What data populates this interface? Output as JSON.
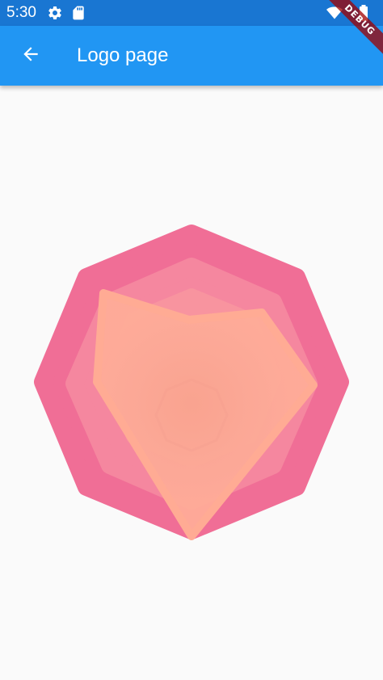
{
  "status_bar": {
    "time": "5:30",
    "icons": [
      "gear-icon",
      "sd-card-icon",
      "wifi-icon",
      "battery-icon"
    ]
  },
  "app_bar": {
    "title": "Logo page",
    "back_icon": "arrow-back-icon"
  },
  "debug_banner": {
    "label": "DEBUG"
  },
  "logo": {
    "shapes": [
      "octagon-outer",
      "octagon-middle",
      "octagon-inner",
      "pentagon-peach"
    ]
  },
  "colors": {
    "status_bar": "#1976d2",
    "app_bar": "#2196f3",
    "background": "#fafafa",
    "outer_octagon": "#f06e96",
    "middle_octagon": "#f5879f",
    "inner_octagon": "#f8949f",
    "pentagon": "#ffab94"
  }
}
